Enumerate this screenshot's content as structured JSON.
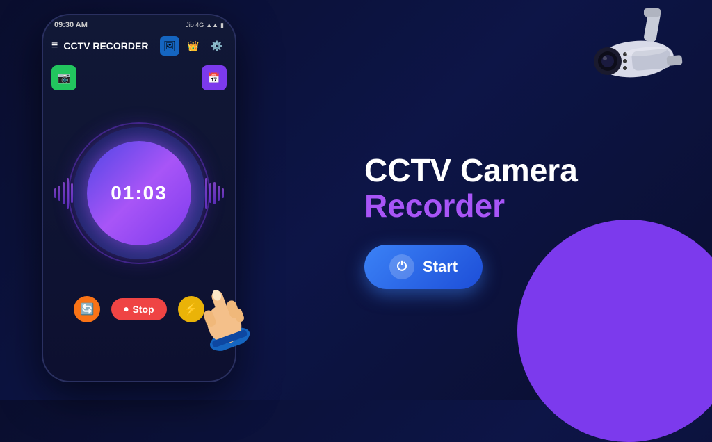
{
  "app": {
    "title": "CCTV RECORDER",
    "status_bar": {
      "time": "09:30 AM",
      "carrier": "Jio 4G",
      "signal": "▲▲",
      "battery": "🔋"
    },
    "header": {
      "menu_icon": "≡",
      "title": "CCTV RECORDER",
      "icons": [
        "🖼",
        "👑",
        "⚙"
      ]
    },
    "top_buttons": {
      "green_icon": "📷",
      "purple_icon": "📅"
    },
    "timer": {
      "value": "01:03"
    },
    "controls": {
      "rotate_icon": "🔄",
      "stop_label": "Stop",
      "flash_icon": "⚡"
    }
  },
  "marketing": {
    "title_line1": "CCTV Camera",
    "title_line2": "Recorder",
    "start_button_label": "Start",
    "power_icon": "⏻"
  },
  "colors": {
    "accent_purple": "#a855f7",
    "accent_blue": "#3b82f6",
    "stop_red": "#ef4444",
    "bg_dark": "#0a0e2e"
  }
}
